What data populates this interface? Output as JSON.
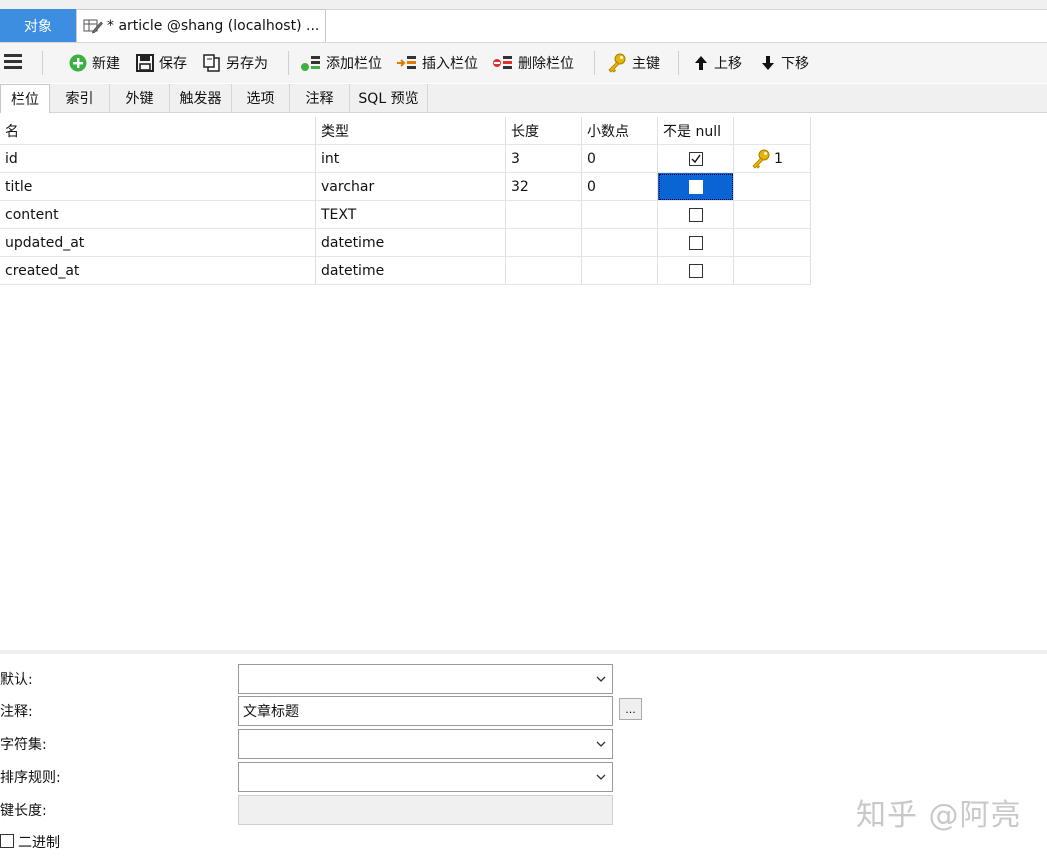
{
  "tabs": {
    "objects": "对象",
    "article": "* article @shang (localhost) ..."
  },
  "toolbar": {
    "new": "新建",
    "save": "保存",
    "save_as": "另存为",
    "add_field": "添加栏位",
    "insert_field": "插入栏位",
    "delete_field": "删除栏位",
    "primary_key": "主键",
    "move_up": "上移",
    "move_down": "下移"
  },
  "subtabs": [
    "栏位",
    "索引",
    "外键",
    "触发器",
    "选项",
    "注释",
    "SQL 预览"
  ],
  "grid": {
    "headers": [
      "名",
      "类型",
      "长度",
      "小数点",
      "不是 null",
      ""
    ],
    "rows": [
      {
        "name": "id",
        "type": "int",
        "length": "3",
        "decimals": "0",
        "not_null": true,
        "key": "1"
      },
      {
        "name": "title",
        "type": "varchar",
        "length": "32",
        "decimals": "0",
        "not_null": false,
        "key": ""
      },
      {
        "name": "content",
        "type": "TEXT",
        "length": "",
        "decimals": "",
        "not_null": false,
        "key": ""
      },
      {
        "name": "updated_at",
        "type": "datetime",
        "length": "",
        "decimals": "",
        "not_null": false,
        "key": ""
      },
      {
        "name": "created_at",
        "type": "datetime",
        "length": "",
        "decimals": "",
        "not_null": false,
        "key": ""
      }
    ]
  },
  "properties": {
    "default_label": "默认:",
    "default_value": "",
    "comment_label": "注释:",
    "comment_value": "文章标题",
    "charset_label": "字符集:",
    "charset_value": "",
    "collation_label": "排序规则:",
    "collation_value": "",
    "key_length_label": "键长度:",
    "key_length_value": "",
    "binary_label": "二进制",
    "ellipsis": "..."
  },
  "watermark": "知乎 @阿亮",
  "colors": {
    "accent": "#3d8ee0",
    "selection": "#0a64d4",
    "key_gold": "#e0a800"
  }
}
